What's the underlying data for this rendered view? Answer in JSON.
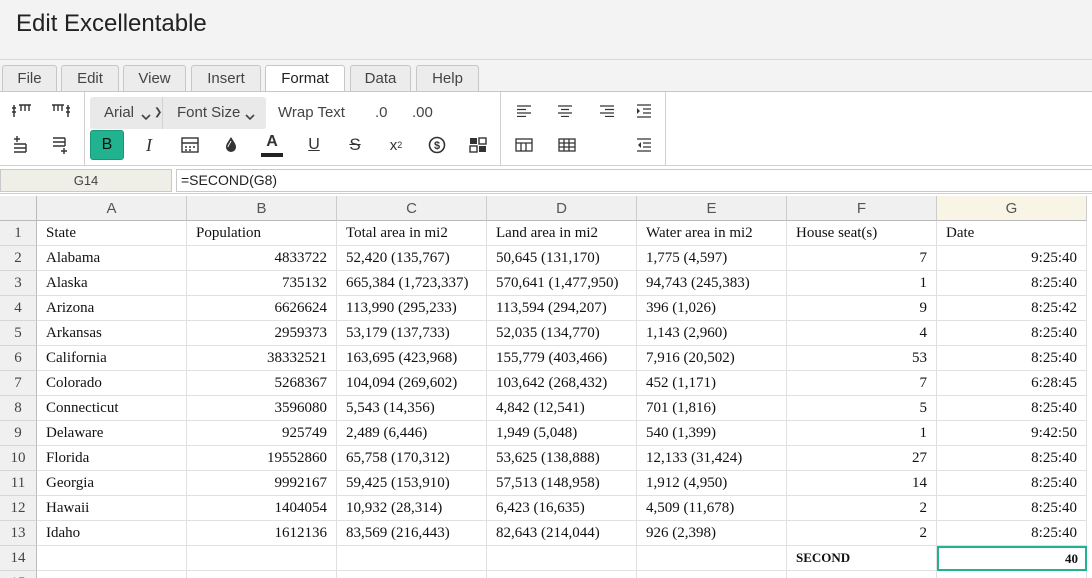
{
  "app": {
    "title": "Edit Excellentable"
  },
  "menu": {
    "tabs": [
      {
        "label": "File"
      },
      {
        "label": "Edit"
      },
      {
        "label": "View"
      },
      {
        "label": "Insert"
      },
      {
        "label": "Format"
      },
      {
        "label": "Data"
      },
      {
        "label": "Help"
      }
    ],
    "active": "Format"
  },
  "toolbar": {
    "font_family": "Arial",
    "font_size": "Font Size",
    "wrap_text": "Wrap Text",
    "decrease_decimal": ".0",
    "increase_decimal": ".00",
    "bold_label": "B",
    "italic_label": "I",
    "font_color_label": "A",
    "underline_label": "U",
    "strike_label": "S",
    "superscript_label": "x",
    "superscript_sup": "2",
    "accent_color": "#21b38f"
  },
  "formula_bar": {
    "name_box": "G14",
    "formula": "=SECOND(G8)"
  },
  "sheet": {
    "columns": [
      "A",
      "B",
      "C",
      "D",
      "E",
      "F",
      "G"
    ],
    "rows": [
      [
        "State",
        "Population",
        "Total area in mi2",
        "Land area in mi2",
        "Water area in mi2",
        "House seat(s)",
        "Date"
      ],
      [
        "Alabama",
        "4833722",
        "52,420 (135,767)",
        "50,645 (131,170)",
        "1,775 (4,597)",
        "7",
        "9:25:40"
      ],
      [
        "Alaska",
        "735132",
        "665,384 (1,723,337)",
        "570,641 (1,477,950)",
        "94,743 (245,383)",
        "1",
        "8:25:40"
      ],
      [
        "Arizona",
        "6626624",
        "113,990 (295,233)",
        "113,594 (294,207)",
        "396 (1,026)",
        "9",
        "8:25:42"
      ],
      [
        "Arkansas",
        "2959373",
        "53,179 (137,733)",
        "52,035 (134,770)",
        "1,143 (2,960)",
        "4",
        "8:25:40"
      ],
      [
        "California",
        "38332521",
        "163,695 (423,968)",
        "155,779 (403,466)",
        "7,916 (20,502)",
        "53",
        "8:25:40"
      ],
      [
        "Colorado",
        "5268367",
        "104,094 (269,602)",
        "103,642 (268,432)",
        "452 (1,171)",
        "7",
        "6:28:45"
      ],
      [
        "Connecticut",
        "3596080",
        "5,543 (14,356)",
        "4,842 (12,541)",
        "701 (1,816)",
        "5",
        "8:25:40"
      ],
      [
        "Delaware",
        "925749",
        "2,489 (6,446)",
        "1,949 (5,048)",
        "540 (1,399)",
        "1",
        "9:42:50"
      ],
      [
        "Florida",
        "19552860",
        "65,758 (170,312)",
        "53,625 (138,888)",
        "12,133 (31,424)",
        "27",
        "8:25:40"
      ],
      [
        "Georgia",
        "9992167",
        "59,425 (153,910)",
        "57,513 (148,958)",
        "1,912 (4,950)",
        "14",
        "8:25:40"
      ],
      [
        "Hawaii",
        "1404054",
        "10,932 (28,314)",
        "6,423 (16,635)",
        "4,509 (11,678)",
        "2",
        "8:25:40"
      ],
      [
        "Idaho",
        "1612136",
        "83,569 (216,443)",
        "82,643 (214,044)",
        "926 (2,398)",
        "2",
        "8:25:40"
      ],
      [
        "",
        "",
        "",
        "",
        "",
        "SECOND",
        "40"
      ],
      [
        "",
        "",
        "",
        "",
        "",
        "",
        ""
      ]
    ]
  }
}
